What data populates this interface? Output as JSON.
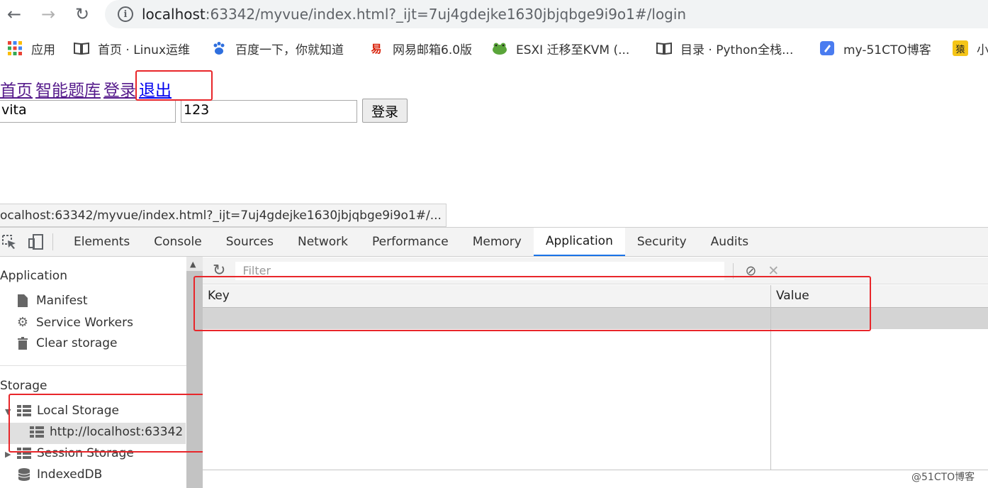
{
  "browser": {
    "url_host": "localhost",
    "url_rest": ":63342/myvue/index.html?_ijt=7uj4gdejke1630jbjqbge9i9o1#/login"
  },
  "bookmarks": [
    {
      "label": "应用",
      "icon": "apps-grid-icon"
    },
    {
      "label": "首页 · Linux运维",
      "icon": "book-icon"
    },
    {
      "label": "百度一下，你就知道",
      "icon": "baidu-paw-icon"
    },
    {
      "label": "网易邮箱6.0版",
      "icon": "netease-mail-icon"
    },
    {
      "label": "ESXI 迁移至KVM (...",
      "icon": "frog-icon"
    },
    {
      "label": "目录 · Python全栈...",
      "icon": "book-icon"
    },
    {
      "label": "my-51CTO博客",
      "icon": "pen-icon"
    },
    {
      "label": "小",
      "icon": "ape-icon"
    }
  ],
  "page": {
    "nav": [
      "首页",
      "智能题库",
      "登录",
      "退出"
    ],
    "username_value": "vita",
    "password_value": "123",
    "login_button": "登录"
  },
  "status_url": "ocalhost:63342/myvue/index.html?_ijt=7uj4gdejke1630jbjqbge9i9o1#/...",
  "devtools": {
    "tabs": [
      "Elements",
      "Console",
      "Sources",
      "Network",
      "Performance",
      "Memory",
      "Application",
      "Security",
      "Audits"
    ],
    "active_tab": "Application",
    "sidebar": {
      "application_header": "Application",
      "application_items": [
        "Manifest",
        "Service Workers",
        "Clear storage"
      ],
      "storage_header": "Storage",
      "local_storage": "Local Storage",
      "local_storage_origin": "http://localhost:63342",
      "session_storage": "Session Storage",
      "indexeddb": "IndexedDB"
    },
    "filter_placeholder": "Filter",
    "table": {
      "key_header": "Key",
      "value_header": "Value"
    }
  },
  "watermark": "@51CTO博客",
  "colors": {
    "annotation": "#e8262a",
    "active_tab": "#1a73e8",
    "visited_link": "#551a8b",
    "link": "#0000ee"
  }
}
